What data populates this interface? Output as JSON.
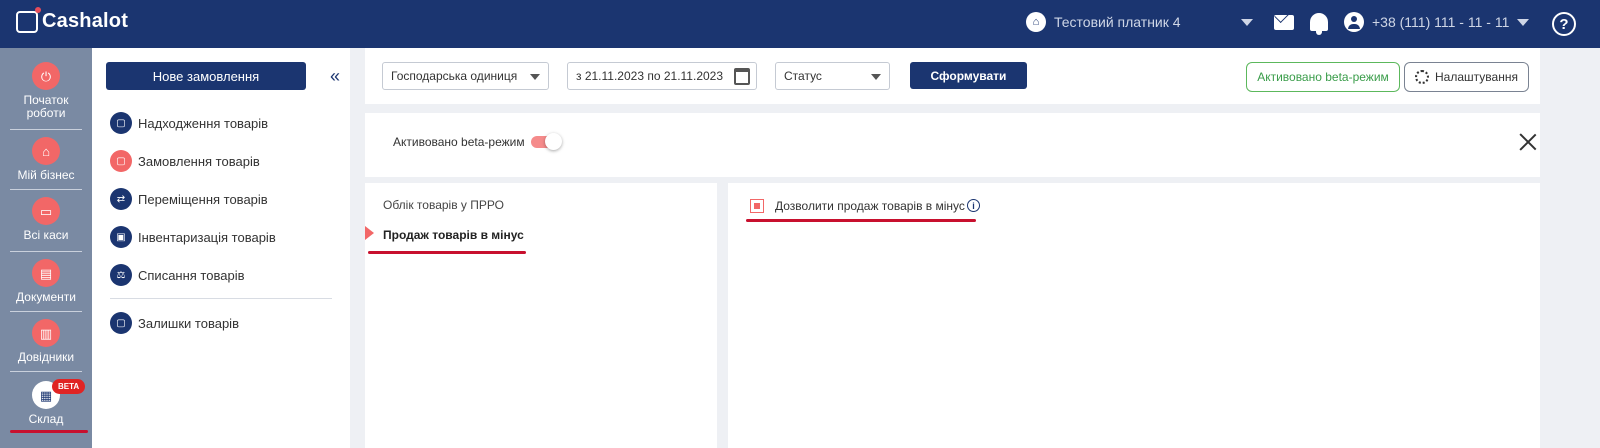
{
  "header": {
    "logo": "Cashalot",
    "payer": "Тестовий платник 4",
    "phone": "+38 (111) 111 - 11 - 11",
    "help": "?"
  },
  "leftnav": {
    "items": [
      {
        "label": "Початок роботи"
      },
      {
        "label": "Мій бізнес"
      },
      {
        "label": "Всі каси"
      },
      {
        "label": "Документи"
      },
      {
        "label": "Довідники"
      },
      {
        "label": "Склад",
        "badge": "BETA"
      }
    ]
  },
  "subnav": {
    "new_order": "Нове замовлення",
    "items": [
      {
        "label": "Надходження товарів"
      },
      {
        "label": "Замовлення товарів"
      },
      {
        "label": "Переміщення товарів"
      },
      {
        "label": "Інвентаризація товарів"
      },
      {
        "label": "Списання товарів"
      },
      {
        "label": "Залишки товарів"
      }
    ]
  },
  "filters": {
    "unit": "Господарська одиниця",
    "date_range": "з 21.11.2023 по 21.11.2023",
    "status": "Статус",
    "submit": "Сформувати",
    "beta_mode": "Активовано beta-режим",
    "settings": "Налаштування"
  },
  "beta_panel": {
    "label": "Активовано beta-режим"
  },
  "tree": {
    "title": "Облік товарів у ПРРО",
    "item": "Продаж товарів в мінус"
  },
  "options": {
    "allow_negative": "Дозволити продаж товарів в мінус",
    "info": "i"
  }
}
